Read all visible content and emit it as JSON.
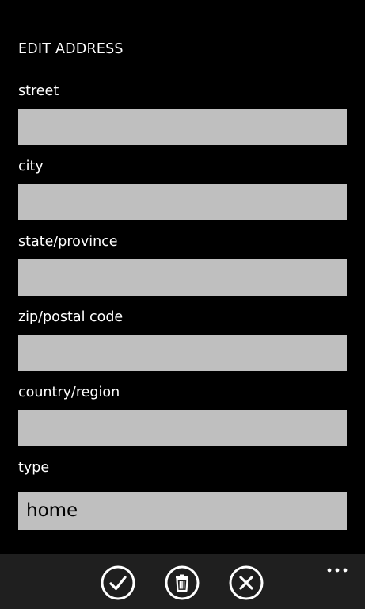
{
  "page": {
    "title": "EDIT ADDRESS"
  },
  "fields": [
    {
      "label": "street",
      "value": ""
    },
    {
      "label": "city",
      "value": ""
    },
    {
      "label": "state/province",
      "value": ""
    },
    {
      "label": "zip/postal code",
      "value": ""
    },
    {
      "label": "country/region",
      "value": ""
    }
  ],
  "type_field": {
    "label": "type",
    "selected": "home"
  },
  "app_bar": {
    "buttons": [
      {
        "icon": "check-icon",
        "action": "save"
      },
      {
        "icon": "trash-icon",
        "action": "delete"
      },
      {
        "icon": "close-icon",
        "action": "cancel"
      }
    ],
    "more_icon": "ellipsis-icon"
  },
  "colors": {
    "background": "#000000",
    "text": "#ffffff",
    "input_background": "#bfbfbf",
    "app_bar_background": "#1f1f1f"
  }
}
